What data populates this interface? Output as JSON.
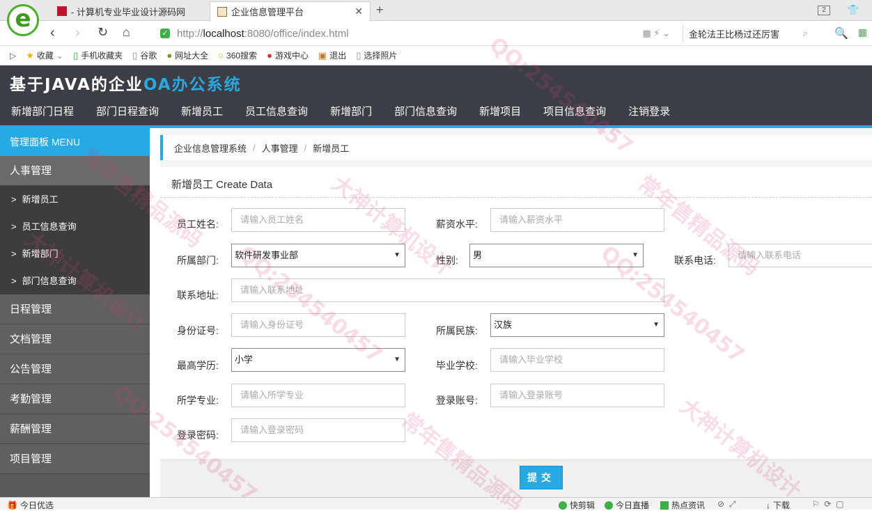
{
  "browser": {
    "tabs": [
      {
        "title": "- 计算机专业毕业设计源码网"
      },
      {
        "title": "企业信息管理平台"
      }
    ],
    "tab_count": "2",
    "url_prefix": "http://",
    "url_host": "localhost",
    "url_rest": ":8080/office/index.html",
    "search_text": "金轮法王比杨过还厉害",
    "bookmarks": [
      "收藏",
      "手机收藏夹",
      "谷歌",
      "网址大全",
      "360搜索",
      "游戏中心",
      "退出",
      "选择照片"
    ]
  },
  "app": {
    "brand_main": "基于JAVA的企业",
    "brand_accent": "OA办公系统",
    "nav": [
      "新增部门日程",
      "部门日程查询",
      "新增员工",
      "员工信息查询",
      "新增部门",
      "部门信息查询",
      "新增项目",
      "项目信息查询",
      "注销登录"
    ],
    "accent_color": "#27a9e3"
  },
  "sidebar": {
    "header": "管理面板 MENU",
    "groups": [
      {
        "label": "人事管理",
        "items": [
          "新增员工",
          "员工信息查询",
          "新增部门",
          "部门信息查询"
        ]
      },
      {
        "label": "日程管理"
      },
      {
        "label": "文档管理"
      },
      {
        "label": "公告管理"
      },
      {
        "label": "考勤管理"
      },
      {
        "label": "薪酬管理"
      },
      {
        "label": "项目管理"
      }
    ]
  },
  "breadcrumb": [
    "企业信息管理系统",
    "人事管理",
    "新增员工"
  ],
  "form": {
    "title": "新增员工 Create Data",
    "name_label": "员工姓名:",
    "name_placeholder": "请输入员工姓名",
    "salary_label": "薪资水平:",
    "salary_placeholder": "请输入薪资水平",
    "dept_label": "所属部门:",
    "dept_value": "软件研发事业部",
    "gender_label": "性别:",
    "gender_value": "男",
    "phone_label": "联系电话:",
    "phone_placeholder": "请输入联系电话",
    "address_label": "联系地址:",
    "address_placeholder": "请输入联系地址",
    "idcard_label": "身份证号:",
    "idcard_placeholder": "请输入身份证号",
    "ethnic_label": "所属民族:",
    "ethnic_value": "汉族",
    "edu_label": "最高学历:",
    "edu_value": "小学",
    "school_label": "毕业学校:",
    "school_placeholder": "请输入毕业学校",
    "major_label": "所学专业:",
    "major_placeholder": "请输入所学专业",
    "account_label": "登录账号:",
    "account_placeholder": "请输入登录账号",
    "password_label": "登录密码:",
    "password_placeholder": "请输入登录密码",
    "submit_label": "提交"
  },
  "statusbar": {
    "left": "今日优选",
    "items": [
      "快剪辑",
      "今日直播",
      "热点资讯",
      "下载"
    ]
  },
  "watermarks": [
    "QQ:254540457",
    "大神计算机设计",
    "常年售精品源码"
  ]
}
